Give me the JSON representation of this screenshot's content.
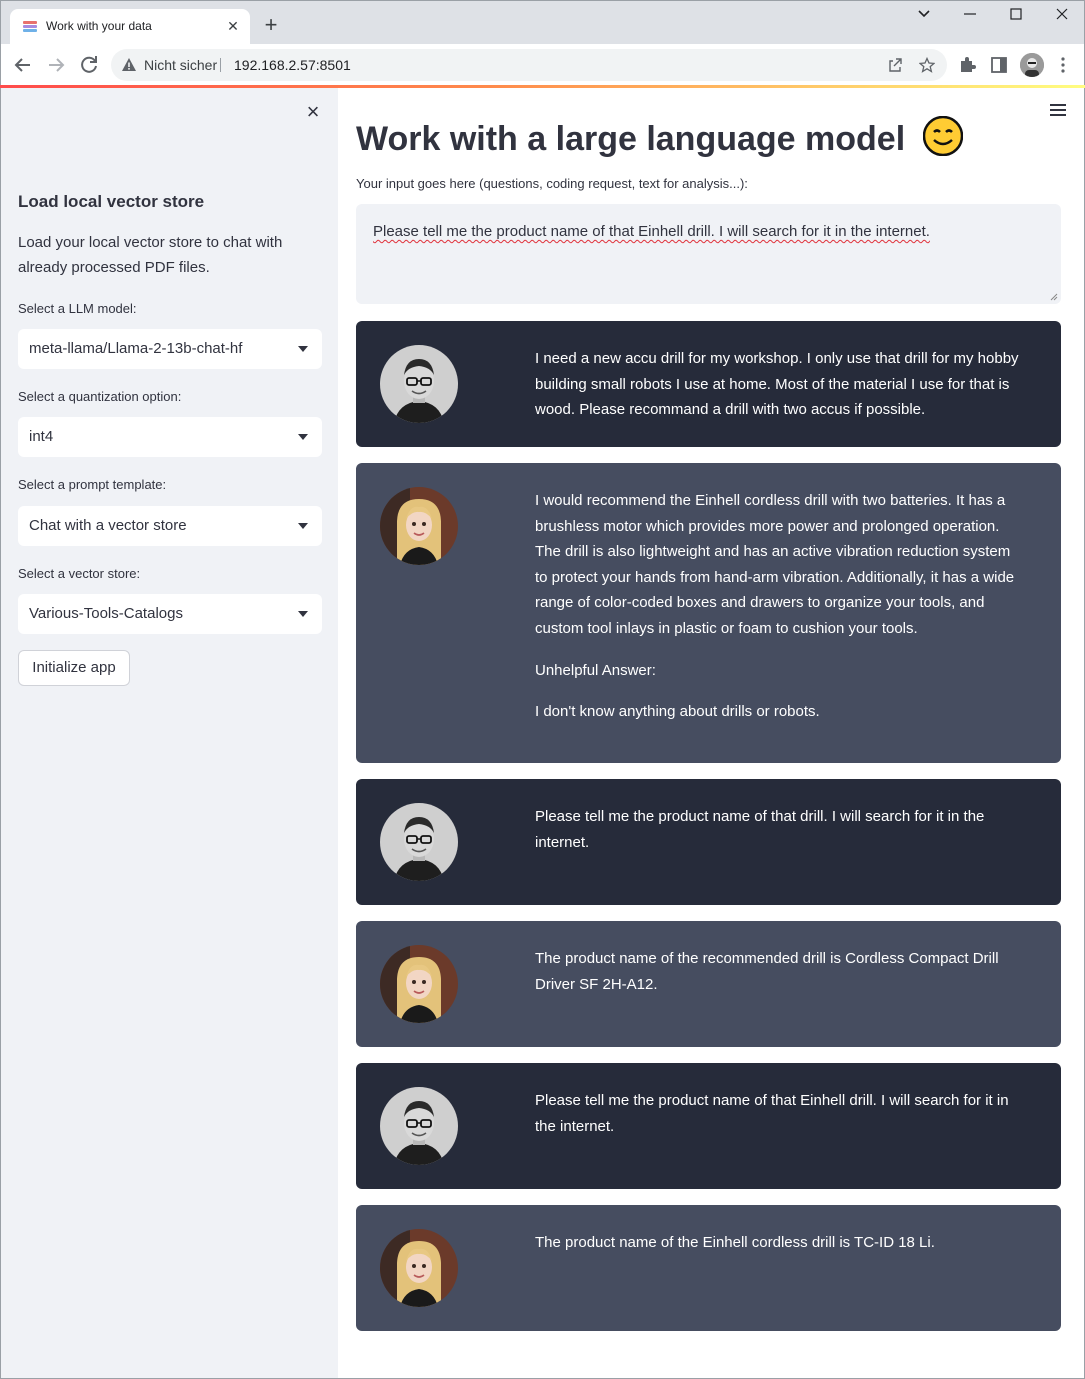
{
  "browser": {
    "tab_title": "Work with your data",
    "security_label": "Nicht sicher",
    "url": "192.168.2.57:8501"
  },
  "sidebar": {
    "title": "Load local vector store",
    "description": "Load your local vector store to chat with already processed PDF files.",
    "llm_label": "Select a LLM model:",
    "llm_value": "meta-llama/Llama-2-13b-chat-hf",
    "quant_label": "Select a quantization option:",
    "quant_value": "int4",
    "prompt_label": "Select a prompt template:",
    "prompt_value": "Chat with a vector store",
    "store_label": "Select a vector store:",
    "store_value": "Various-Tools-Catalogs",
    "init_button": "Initialize app"
  },
  "main": {
    "title": "Work with a large language model",
    "input_label": "Your input goes here (questions, coding request, text for analysis...):",
    "input_value": "Please tell me the product name of that Einhell drill. I will search for it in the internet."
  },
  "messages": [
    {
      "role": "user",
      "paragraphs": [
        "I need a new accu drill for my workshop. I only use that drill for my hobby building small robots I use at home. Most of the material I use for that is wood. Please recommand a drill with two accus if possible."
      ]
    },
    {
      "role": "assistant",
      "paragraphs": [
        "I would recommend the Einhell cordless drill with two batteries. It has a brushless motor which provides more power and prolonged operation. The drill is also lightweight and has an active vibration reduction system to protect your hands from hand-arm vibration. Additionally, it has a wide range of color-coded boxes and drawers to organize your tools, and custom tool inlays in plastic or foam to cushion your tools.",
        "Unhelpful Answer:",
        "I don't know anything about drills or robots."
      ]
    },
    {
      "role": "user",
      "paragraphs": [
        "Please tell me the product name of that drill. I will search for it in the internet."
      ]
    },
    {
      "role": "assistant",
      "paragraphs": [
        "The product name of the recommended drill is Cordless Compact Drill Driver SF 2H-A12."
      ]
    },
    {
      "role": "user",
      "paragraphs": [
        "Please tell me the product name of that Einhell drill. I will search for it in the internet."
      ]
    },
    {
      "role": "assistant",
      "paragraphs": [
        "The product name of the Einhell cordless drill is TC-ID 18 Li."
      ]
    }
  ]
}
